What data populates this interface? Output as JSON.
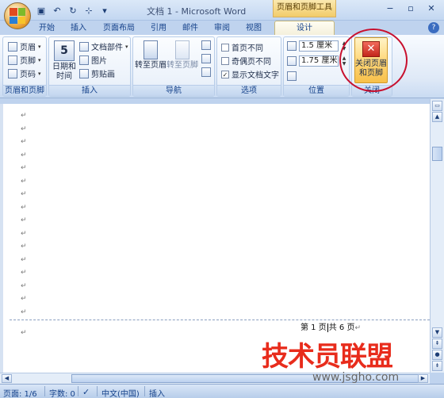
{
  "window": {
    "title": "文档 1 - Microsoft Word",
    "context_tool_title": "页眉和页脚工具",
    "controls": [
      "−",
      "▫",
      "✕"
    ]
  },
  "tabs": [
    {
      "label": "开始"
    },
    {
      "label": "插入"
    },
    {
      "label": "页面布局"
    },
    {
      "label": "引用"
    },
    {
      "label": "邮件"
    },
    {
      "label": "审阅"
    },
    {
      "label": "视图"
    },
    {
      "label": "设计",
      "active": true
    }
  ],
  "ribbon": {
    "group_hf": {
      "label": "页眉和页脚",
      "items": [
        "页眉",
        "页脚",
        "页码"
      ]
    },
    "group_insert": {
      "label": "插入",
      "datetime": "日期和\n时间",
      "datetime_line1": "日期和",
      "datetime_line2": "时间",
      "calendar_digit": "5",
      "items": [
        "文档部件",
        "图片",
        "剪贴画"
      ]
    },
    "group_nav": {
      "label": "导航",
      "goto_header": "转至页眉",
      "goto_footer": "转至页脚"
    },
    "group_options": {
      "label": "选项",
      "options": [
        {
          "label": "首页不同",
          "checked": false
        },
        {
          "label": "奇偶页不同",
          "checked": false
        },
        {
          "label": "显示文档文字",
          "checked": true
        }
      ]
    },
    "group_position": {
      "label": "位置",
      "header_distance": "1.5 厘米",
      "footer_distance": "1.75 厘米"
    },
    "group_close": {
      "label": "关闭",
      "close_line1": "关闭页眉",
      "close_line2": "和页脚"
    }
  },
  "document": {
    "paragraph_mark": "↵",
    "paragraph_count": 16,
    "footer_part1": "第 1 页",
    "footer_part2": "共 6 页",
    "footer_mark": "↵",
    "after_footer_mark": "↵"
  },
  "statusbar": {
    "page": "页面: 1/6",
    "words": "字数: 0",
    "language": "中文(中国)",
    "mode": "插入"
  },
  "watermark": {
    "main": "技术员联盟",
    "sub": "www.jsgho.com"
  },
  "colors": {
    "accent": "#15428b",
    "context_tab": "#f2cc6a",
    "highlight_circle": "#c8102e",
    "watermark": "#e82c1c"
  }
}
